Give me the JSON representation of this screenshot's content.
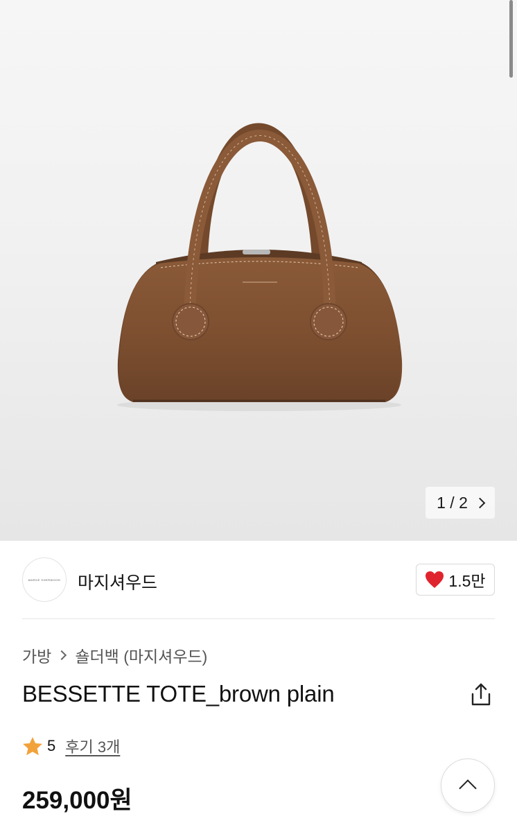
{
  "gallery": {
    "current": "1",
    "separator": "/",
    "total": "2",
    "image_subject": "brown leather bag"
  },
  "seller": {
    "logo_text": "MARGE SHERWOOD",
    "name": "마지셔우드"
  },
  "like": {
    "icon": "heart-icon",
    "count": "1.5만",
    "color": "#e0242e"
  },
  "breadcrumb": {
    "items": [
      "가방",
      "숄더백 (마지셔우드)"
    ]
  },
  "product": {
    "title": "BESSETTE TOTE_brown plain",
    "rating": "5",
    "reviews_label": "후기 3개",
    "price": "259,000원",
    "star_color": "#f2a23a"
  },
  "icons": {
    "share": "share-icon",
    "scroll_top": "chevron-up-icon"
  }
}
